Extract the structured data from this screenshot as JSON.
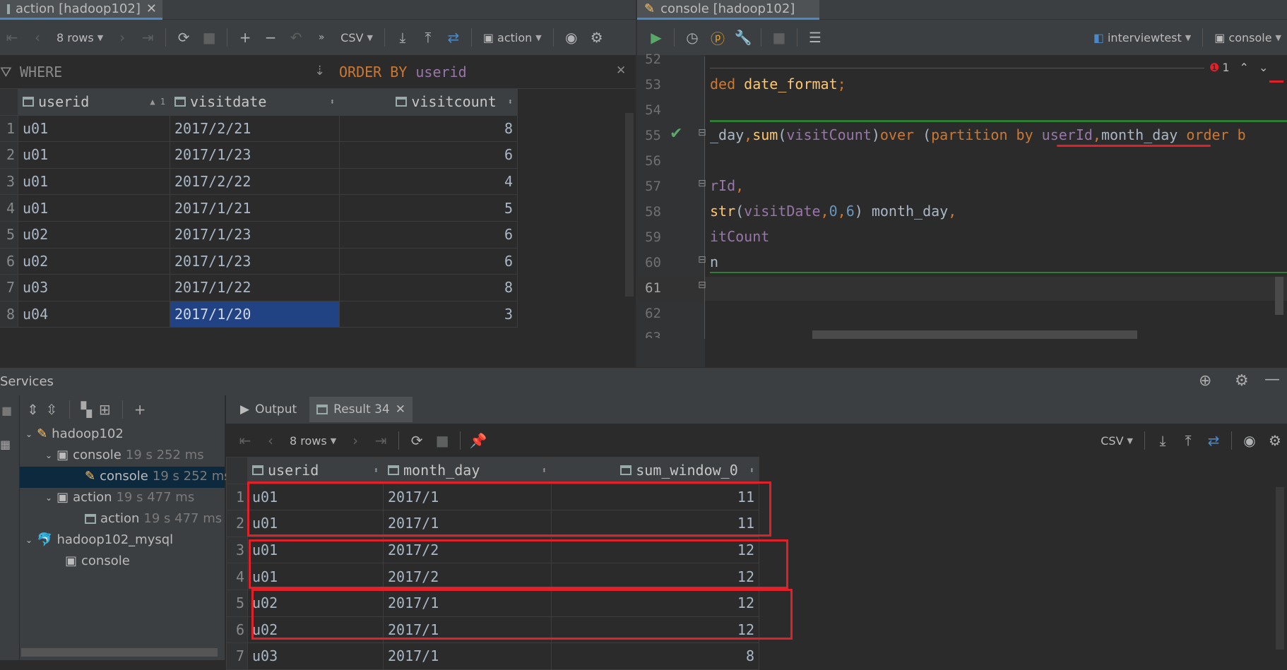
{
  "left_tab": {
    "title": "action [hadoop102]"
  },
  "right_tab": {
    "title": "console [hadoop102]"
  },
  "left_toolbar": {
    "rows": "8 rows",
    "format": "CSV",
    "session": "action"
  },
  "filter": {
    "where": "WHERE",
    "order_by_kw": "ORDER BY",
    "order_by_col": "userid"
  },
  "action_table": {
    "columns": [
      "userid",
      "visitdate",
      "visitcount"
    ],
    "sort_indicator": "1",
    "rows": [
      {
        "n": "1",
        "userid": "u01",
        "visitdate": "2017/2/21",
        "visitcount": "8"
      },
      {
        "n": "2",
        "userid": "u01",
        "visitdate": "2017/1/23",
        "visitcount": "6"
      },
      {
        "n": "3",
        "userid": "u01",
        "visitdate": "2017/2/22",
        "visitcount": "4"
      },
      {
        "n": "4",
        "userid": "u01",
        "visitdate": "2017/1/21",
        "visitcount": "5"
      },
      {
        "n": "5",
        "userid": "u02",
        "visitdate": "2017/1/23",
        "visitcount": "6"
      },
      {
        "n": "6",
        "userid": "u02",
        "visitdate": "2017/1/23",
        "visitcount": "6"
      },
      {
        "n": "7",
        "userid": "u03",
        "visitdate": "2017/1/22",
        "visitcount": "8"
      },
      {
        "n": "8",
        "userid": "u04",
        "visitdate": "2017/1/20",
        "visitcount": "3"
      }
    ]
  },
  "right_toolbar": {
    "schema": "interviewtest",
    "session": "console",
    "warnings": "1"
  },
  "editor": {
    "line_numbers": [
      "52",
      "53",
      "54",
      "55",
      "56",
      "57",
      "58",
      "59",
      "60",
      "61",
      "62",
      "63"
    ],
    "l53": {
      "a": "ded",
      "b": "date_format",
      "c": ";"
    },
    "l55": {
      "a": "_day",
      "b": ",",
      "c": "sum",
      "d": "(",
      "e": "visitCount",
      "f": ")",
      "g": "over",
      "h": " (",
      "i": "partition by",
      "j": " userId",
      "k": ",",
      "l": "month_day",
      "m": " order b"
    },
    "l57": {
      "a": "rId",
      "b": ","
    },
    "l58": {
      "a": "str",
      "b": "(",
      "c": "visitDate",
      "d": ",",
      "e": "0",
      "f": ",",
      "g": "6",
      "h": ") month_day",
      "i": ","
    },
    "l59": {
      "a": "itCount"
    },
    "l60": {
      "a": "n"
    }
  },
  "services": {
    "title": "Services",
    "tree": {
      "hadoop102": "hadoop102",
      "console_group": "console",
      "console_group_time": "19 s 252 ms",
      "console_item": "console",
      "console_item_time": "19 s 252 ms",
      "action_group": "action",
      "action_group_time": "19 s 477 ms",
      "action_item": "action",
      "action_item_time": "19 s 477 ms",
      "mysql": "hadoop102_mysql",
      "mysql_console": "console"
    },
    "tabs": {
      "output": "Output",
      "result": "Result 34"
    },
    "result_toolbar": {
      "rows": "8 rows",
      "format": "CSV"
    },
    "result_table": {
      "columns": [
        "userid",
        "month_day",
        "sum_window_0"
      ],
      "rows": [
        {
          "n": "1",
          "userid": "u01",
          "month_day": "2017/1",
          "sum": "11"
        },
        {
          "n": "2",
          "userid": "u01",
          "month_day": "2017/1",
          "sum": "11"
        },
        {
          "n": "3",
          "userid": "u01",
          "month_day": "2017/2",
          "sum": "12"
        },
        {
          "n": "4",
          "userid": "u01",
          "month_day": "2017/2",
          "sum": "12"
        },
        {
          "n": "5",
          "userid": "u02",
          "month_day": "2017/1",
          "sum": "12"
        },
        {
          "n": "6",
          "userid": "u02",
          "month_day": "2017/1",
          "sum": "12"
        },
        {
          "n": "7",
          "userid": "u03",
          "month_day": "2017/1",
          "sum": "8"
        }
      ]
    }
  },
  "colors": {
    "accent": "#4a88c7",
    "selection": "#214283",
    "annotation_red": "#e0212a",
    "keyword": "#cc7832",
    "function": "#ffc66d",
    "identifier": "#9876aa"
  }
}
